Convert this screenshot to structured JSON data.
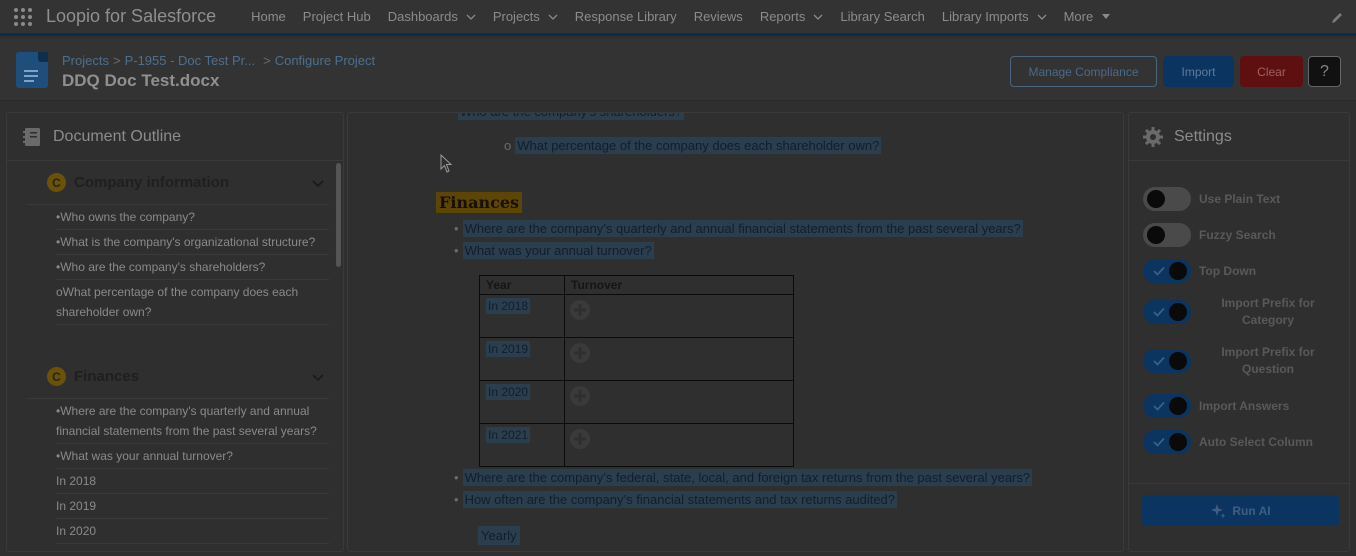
{
  "app": {
    "name": "Loopio for Salesforce",
    "nav": [
      {
        "label": "Home",
        "dropdown": false
      },
      {
        "label": "Project Hub",
        "dropdown": false
      },
      {
        "label": "Dashboards",
        "dropdown": true
      },
      {
        "label": "Projects",
        "dropdown": true
      },
      {
        "label": "Response Library",
        "dropdown": false
      },
      {
        "label": "Reviews",
        "dropdown": false
      },
      {
        "label": "Reports",
        "dropdown": true
      },
      {
        "label": "Library Search",
        "dropdown": false
      },
      {
        "label": "Library Imports",
        "dropdown": true
      },
      {
        "label": "More",
        "dropdown": true
      }
    ]
  },
  "header": {
    "breadcrumbs": [
      "Projects",
      "P-1955 - Doc Test Pr...",
      "Configure Project"
    ],
    "breadcrumb_sep": ">",
    "title": "DDQ Doc Test.docx",
    "buttons": {
      "manage": "Manage Compliance",
      "import": "Import",
      "clear": "Clear",
      "help": "?"
    }
  },
  "outline": {
    "title": "Document Outline",
    "sections": [
      {
        "badge": "C",
        "title": "Company information",
        "items": [
          "•Who owns the company?",
          "•What is the company's organizational structure?",
          "•Who are the company's shareholders?",
          "oWhat percentage of the company does each shareholder own?"
        ]
      },
      {
        "badge": "C",
        "title": "Finances",
        "items": [
          "•Where are the company's quarterly and annual financial statements from the past several years?",
          "•What was your annual turnover?",
          "In 2018",
          "In 2019",
          "In 2020"
        ]
      }
    ]
  },
  "document": {
    "top_cut_text": "Who are the company's shareholders?",
    "sub_bullet_marker": "o",
    "sub_bullet": "What percentage of the company does each shareholder own?",
    "bullet_marker": "•",
    "section_heading": "Finances",
    "bullets_a": [
      "Where are the company’s quarterly and annual financial statements from the past several years?",
      "What was your annual turnover?"
    ],
    "table": {
      "headers": [
        "Year",
        "Turnover"
      ],
      "rows": [
        "In 2018",
        "In 2019",
        "In 2020",
        "In 2021"
      ]
    },
    "bullets_b": [
      "Where are the company’s federal, state, local, and foreign tax returns from the past several years?",
      "How often are the company’s financial statements and tax returns audited?"
    ],
    "answer": "Yearly"
  },
  "settings": {
    "title": "Settings",
    "toggles": [
      {
        "label": "Use Plain Text",
        "on": false
      },
      {
        "label": "Fuzzy Search",
        "on": false
      },
      {
        "label": "Top Down",
        "on": true
      },
      {
        "label": "Import Prefix for Category",
        "on": true
      },
      {
        "label": "Import Prefix for Question",
        "on": true
      },
      {
        "label": "Import Answers",
        "on": true
      },
      {
        "label": "Auto Select Column",
        "on": true
      }
    ],
    "run_ai": "Run AI"
  },
  "colors": {
    "accent": "#0b3560",
    "clear": "#5e1010",
    "badge": "#6b5208",
    "highlight": "#2b3e4d"
  }
}
